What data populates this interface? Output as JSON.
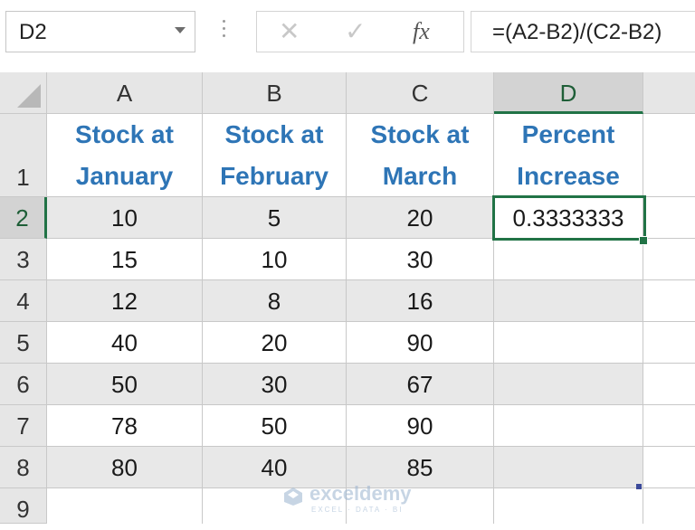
{
  "formula_bar": {
    "name_box": "D2",
    "cancel_glyph": "✕",
    "enter_glyph": "✓",
    "fx_label": "fx",
    "formula": "=(A2-B2)/(C2-B2)"
  },
  "columns": [
    "A",
    "B",
    "C",
    "D"
  ],
  "rows": [
    "1",
    "2",
    "3",
    "4",
    "5",
    "6",
    "7",
    "8",
    "9"
  ],
  "header_row": {
    "a_line1": "Stock at",
    "a_line2": "January",
    "b_line1": "Stock at",
    "b_line2": "February",
    "c_line1": "Stock at",
    "c_line2": "March",
    "d_line1": "Percent",
    "d_line2": "Increase"
  },
  "data_rows": [
    [
      "10",
      "5",
      "20",
      "0.3333333"
    ],
    [
      "15",
      "10",
      "30",
      ""
    ],
    [
      "12",
      "8",
      "16",
      ""
    ],
    [
      "40",
      "20",
      "90",
      ""
    ],
    [
      "50",
      "30",
      "67",
      ""
    ],
    [
      "78",
      "50",
      "90",
      ""
    ],
    [
      "80",
      "40",
      "85",
      ""
    ]
  ],
  "selected_cell": "D2",
  "watermark": {
    "name": "exceldemy",
    "tagline": "EXCEL · DATA · BI"
  },
  "colors": {
    "accent_green": "#217346",
    "header_text_blue": "#2e75b6"
  }
}
